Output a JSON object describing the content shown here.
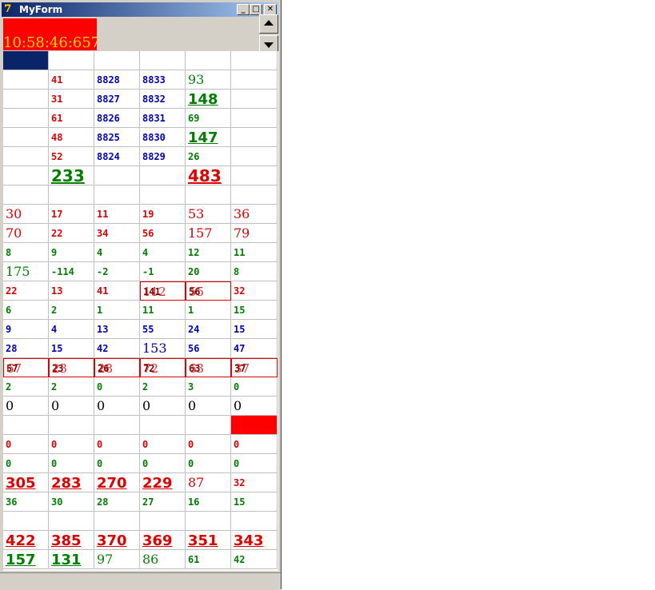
{
  "window": {
    "title": "MyForm",
    "app_icon": "7"
  },
  "clock": "10:58:46:657",
  "colors": {
    "red": "#e00000",
    "green": "#008000",
    "blue": "#0000c0",
    "header": "#0a246a"
  },
  "rows": [
    [
      "",
      "41",
      "8828",
      "8833",
      "93",
      ""
    ],
    [
      "",
      "31",
      "8827",
      "8832",
      "148",
      ""
    ],
    [
      "",
      "61",
      "8826",
      "8831",
      "69",
      ""
    ],
    [
      "",
      "48",
      "8825",
      "8830",
      "147",
      ""
    ],
    [
      "",
      "52",
      "8824",
      "8829",
      "26",
      ""
    ],
    [
      "",
      "233",
      "",
      "",
      "483",
      ""
    ],
    [
      "",
      "",
      "",
      "",
      "",
      ""
    ],
    [
      "30",
      "17",
      "11",
      "19",
      "53",
      "36"
    ],
    [
      "70",
      "22",
      "34",
      "56",
      "157",
      "79"
    ],
    [
      "8",
      "9",
      "4",
      "4",
      "12",
      "11"
    ],
    [
      "175",
      "-114",
      "-2",
      "-1",
      "20",
      "8"
    ],
    [
      "22",
      "13",
      "41",
      "112",
      "55",
      "32"
    ],
    [
      "6",
      "2",
      "1",
      "11",
      "1",
      "15"
    ],
    [
      "9",
      "4",
      "13",
      "55",
      "24",
      "15"
    ],
    [
      "28",
      "15",
      "42",
      "153",
      "56",
      "47"
    ],
    [
      "67",
      "23",
      "28",
      "72",
      "63",
      "37"
    ],
    [
      "2",
      "2",
      "0",
      "2",
      "3",
      "0"
    ],
    [
      "0",
      "0",
      "0",
      "0",
      "0",
      "0"
    ],
    [
      "",
      "",
      "",
      "",
      "",
      ""
    ],
    [
      "0",
      "0",
      "0",
      "0",
      "0",
      "0"
    ],
    [
      "0",
      "0",
      "0",
      "0",
      "0",
      "0"
    ],
    [
      "305",
      "283",
      "270",
      "229",
      "87",
      "32"
    ],
    [
      "36",
      "30",
      "28",
      "27",
      "16",
      "15"
    ],
    [
      "",
      "",
      "",
      "",
      "",
      ""
    ],
    [
      "422",
      "385",
      "370",
      "369",
      "351",
      "343"
    ],
    [
      "157",
      "131",
      "97",
      "86",
      "61",
      "42"
    ]
  ],
  "overlay_texts": {
    "r11c3": "141",
    "r11c4": "56",
    "r15c0": "57",
    "r15c1": "23",
    "r15c2": "26",
    "r15c3": "72",
    "r15c4": "63",
    "r15c5": "37"
  }
}
